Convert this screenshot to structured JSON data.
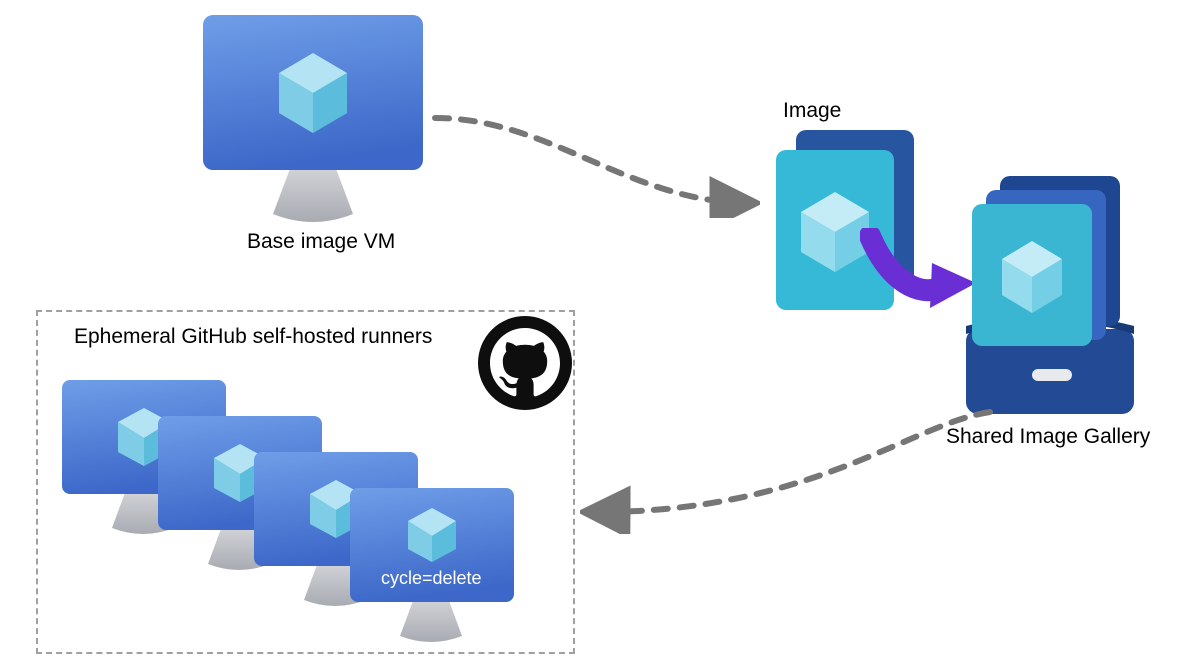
{
  "labels": {
    "base_vm": "Base image VM",
    "image": "Image",
    "shared_gallery": "Shared Image Gallery",
    "ephemeral_box_title": "Ephemeral GitHub self-hosted runners",
    "runner_overlay_text": "cycle=delete"
  }
}
